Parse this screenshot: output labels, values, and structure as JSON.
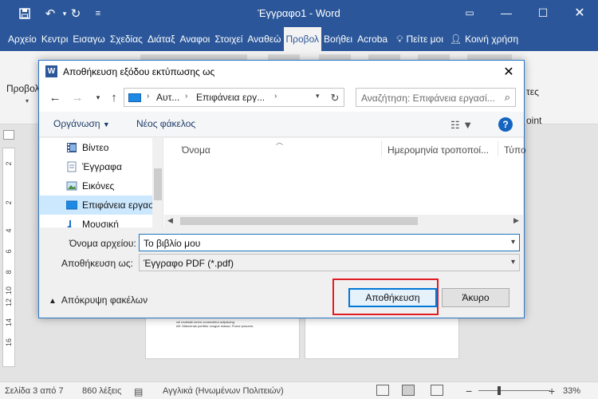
{
  "window": {
    "title": "Έγγραφο1 - Word",
    "icons": [
      "save-icon",
      "undo-icon",
      "redo-icon",
      "customize-toolbar-icon"
    ],
    "controls": [
      "ribbon-display-icon",
      "minimize-icon",
      "maximize-icon",
      "close-icon"
    ]
  },
  "ribbon": {
    "tabs": [
      "Αρχείο",
      "Κεντρι",
      "Εισαγω",
      "Σχεδίας",
      "Διάταξ",
      "Αναφοι",
      "Στοιχεί",
      "Αναθεώ",
      "Προβολ",
      "Βοήθει",
      "Acroba"
    ],
    "active_tab": "Προβολ",
    "tell_me": "Πείτε μοι",
    "share": "Κοινή χρήση",
    "left_label": "Προβολ",
    "right_label_1": "τες",
    "right_label_2": "oint"
  },
  "ruler": [
    "2",
    "2",
    "4",
    "6",
    "8",
    "10",
    "12",
    "14",
    "16"
  ],
  "page_preview_text": [
    "vel molestie lorem consectetur adipiscing",
    "elit. Maecenas porttitor congue massa. Fusce posuere,"
  ],
  "statusbar": {
    "page": "Σελίδα 3 από 7",
    "words": "860 λέξεις",
    "language": "Αγγλικά (Ηνωμένων Πολιτειών)",
    "zoom_value": "33%",
    "zoom_minus": "−",
    "zoom_plus": "+"
  },
  "dialog": {
    "title": "Αποθήκευση εξόδου εκτύπωσης ως",
    "close": "✕",
    "address": [
      "Αυτ...",
      "Επιφάνεια εργ..."
    ],
    "search_placeholder": "Αναζήτηση: Επιφάνεια εργασί...",
    "organize": "Οργάνωση",
    "new_folder": "Νέος φάκελος",
    "help": "?",
    "nav_items": [
      {
        "label": "Βίντεο",
        "icon": "videos-folder-icon",
        "selected": false
      },
      {
        "label": "Έγγραφα",
        "icon": "documents-folder-icon",
        "selected": false
      },
      {
        "label": "Εικόνες",
        "icon": "pictures-folder-icon",
        "selected": false
      },
      {
        "label": "Επιφάνεια εργασ",
        "icon": "desktop-folder-icon",
        "selected": true
      },
      {
        "label": "Μουσική",
        "icon": "music-folder-icon",
        "selected": false
      }
    ],
    "columns": [
      "Όνομα",
      "Ημερομηνία τροποποί...",
      "Τύπο"
    ],
    "filename_label": "Όνομα αρχείου:",
    "filename_value": "Το βιβλίο μου",
    "savetype_label": "Αποθήκευση ως:",
    "savetype_value": "Έγγραφο PDF (*.pdf)",
    "hide_folders": "Απόκρυψη φακέλων",
    "save_button": "Αποθήκευση",
    "cancel_button": "Άκυρο"
  },
  "colors": {
    "word_blue": "#2b579a",
    "highlight_red": "#e21b24",
    "selection": "#cce8ff"
  }
}
